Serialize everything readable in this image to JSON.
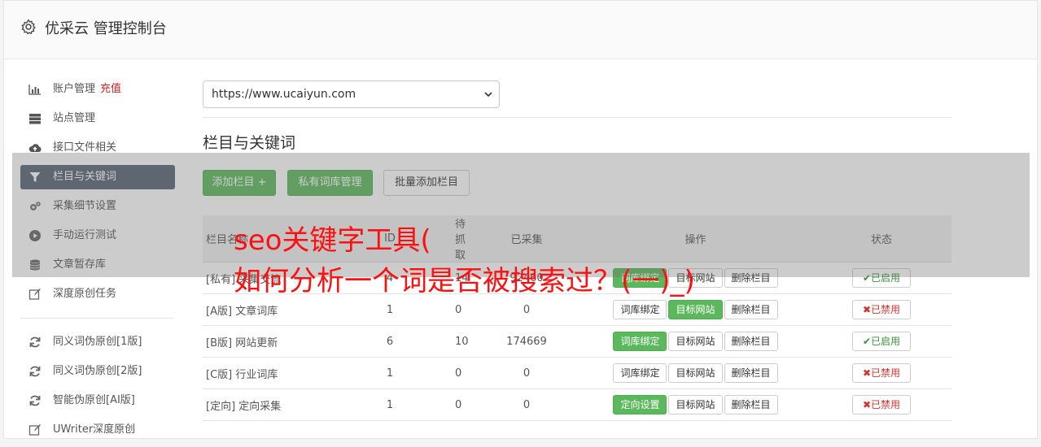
{
  "app_title": "优采云 管理控制台",
  "sidebar": {
    "items": [
      {
        "label": "账户管理",
        "extra": "充值",
        "icon": "bar-chart-icon"
      },
      {
        "label": "站点管理",
        "icon": "server-icon"
      },
      {
        "label": "接口文件相关",
        "icon": "cloud-upload-icon"
      },
      {
        "label": "栏目与关键词",
        "icon": "filter-icon",
        "active": true
      },
      {
        "label": "采集细节设置",
        "icon": "cogs-icon"
      },
      {
        "label": "手动运行测试",
        "icon": "play-circle-icon"
      },
      {
        "label": "文章暂存库",
        "icon": "database-icon"
      },
      {
        "label": "深度原创任务",
        "icon": "edit-icon"
      }
    ],
    "items2": [
      {
        "label": "同义词伪原创[1版]",
        "icon": "refresh-icon"
      },
      {
        "label": "同义词伪原创[2版]",
        "icon": "refresh-icon"
      },
      {
        "label": "智能伪原创[AI版]",
        "icon": "refresh-icon"
      },
      {
        "label": "UWriter深度原创",
        "icon": "edit-icon"
      }
    ]
  },
  "main": {
    "site_select": "https://www.ucaiyun.com",
    "section_title": "栏目与关键词",
    "buttons": {
      "add": "添加栏目 +",
      "private": "私有词库管理",
      "batch": "批量添加栏目"
    },
    "table": {
      "headers": [
        "栏目名称",
        "ID",
        "待抓取",
        "已采集",
        "操作",
        "状态"
      ],
      "rows": [
        {
          "tag": "[私有]",
          "name": "采集交流",
          "id": "4",
          "pending": "14",
          "collected": "92460",
          "op1": "词库绑定",
          "op2": "目标网站",
          "op3": "删除栏目",
          "status": "已启用"
        },
        {
          "tag": "[A版]",
          "name": "文章词库",
          "id": "1",
          "pending": "0",
          "collected": "0",
          "op1": "词库绑定",
          "op2": "目标网站",
          "op3": "删除栏目",
          "status": "已禁用"
        },
        {
          "tag": "[B版]",
          "name": "网站更新",
          "id": "6",
          "pending": "10",
          "collected": "174669",
          "op1": "词库绑定",
          "op2": "目标网站",
          "op3": "删除栏目",
          "status": "已启用"
        },
        {
          "tag": "[C版]",
          "name": "行业词库",
          "id": "1",
          "pending": "0",
          "collected": "0",
          "op1": "词库绑定",
          "op2": "目标网站",
          "op3": "删除栏目",
          "status": "已禁用"
        },
        {
          "tag": "[定向]",
          "name": "定向采集",
          "id": "1",
          "pending": "0",
          "collected": "0",
          "op1": "定向设置",
          "op2": "目标网站",
          "op3": "删除栏目",
          "status": "已禁用"
        }
      ]
    }
  },
  "watermark": {
    "line1": "seo关键字工具(",
    "line2": "如何分析一个词是否被搜索过？(一)_)"
  },
  "colors": {
    "green": "#5cb85c",
    "sidebar_active": "#566573",
    "watermark": "#ff0f0f"
  }
}
